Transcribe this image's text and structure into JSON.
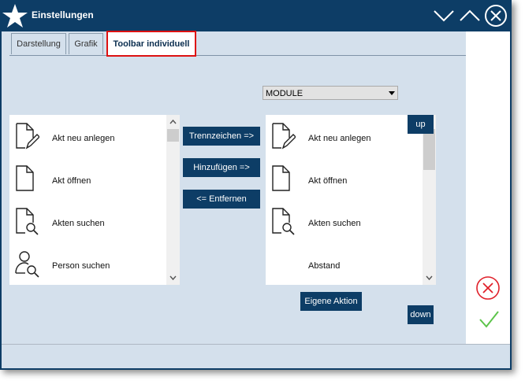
{
  "window": {
    "title": "Einstellungen",
    "buttons": {
      "minimize_icon": "chevron-down-icon",
      "maximize_icon": "chevron-up-icon",
      "close_icon": "close-circle-icon"
    }
  },
  "tabs": [
    {
      "label": "Darstellung",
      "active": false
    },
    {
      "label": "Grafik",
      "active": false
    },
    {
      "label": "Toolbar individuell",
      "active": true
    }
  ],
  "module_select": {
    "value": "MODULE"
  },
  "available_list": {
    "items": [
      {
        "label": "Akt neu anlegen",
        "icon": "new-document-icon"
      },
      {
        "label": "Akt öffnen",
        "icon": "document-icon"
      },
      {
        "label": "Akten suchen",
        "icon": "document-search-icon"
      },
      {
        "label": "Person suchen",
        "icon": "person-search-icon"
      }
    ]
  },
  "toolbar_list": {
    "items": [
      {
        "label": "Akt neu anlegen",
        "icon": "new-document-icon"
      },
      {
        "label": "Akt öffnen",
        "icon": "document-icon"
      },
      {
        "label": "Akten suchen",
        "icon": "document-search-icon"
      },
      {
        "label": "Abstand",
        "icon": ""
      }
    ]
  },
  "actions": {
    "separator": "Trennzeichen =>",
    "add": "Hinzufügen =>",
    "remove": "<= Entfernen",
    "custom": "Eigene Aktion",
    "up": "up",
    "down": "down"
  },
  "colors": {
    "accent": "#0d3d66",
    "panel": "#d4e0ec",
    "cancel": "#e0202a",
    "confirm": "#5cc44a",
    "tab_highlight": "#dd1111"
  }
}
